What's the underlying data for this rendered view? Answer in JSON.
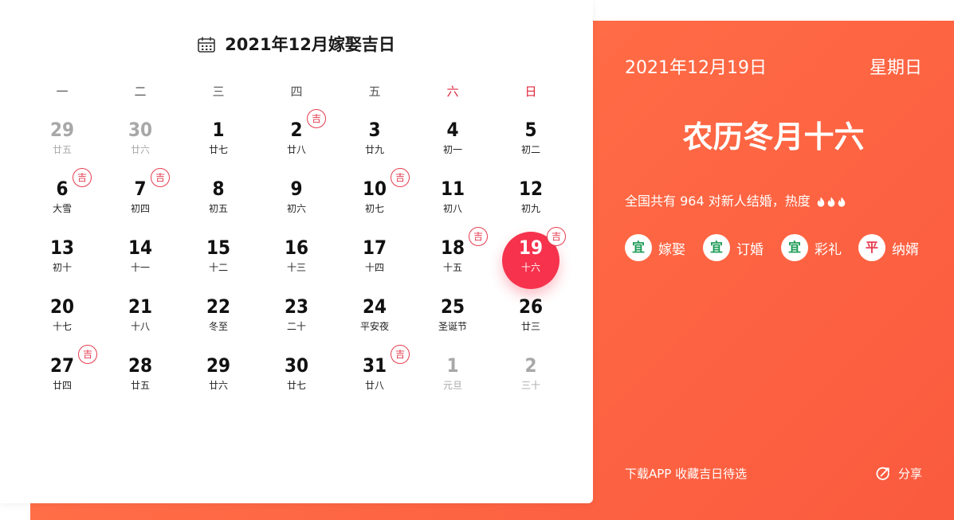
{
  "calendar": {
    "title": "2021年12月嫁娶吉日",
    "weekdays": [
      "一",
      "二",
      "三",
      "四",
      "五",
      "六",
      "日"
    ],
    "badge_label": "吉",
    "days": [
      {
        "num": "29",
        "lunar": "廿五",
        "muted": true,
        "ji": false
      },
      {
        "num": "30",
        "lunar": "廿六",
        "muted": true,
        "ji": false
      },
      {
        "num": "1",
        "lunar": "廿七",
        "muted": false,
        "ji": false
      },
      {
        "num": "2",
        "lunar": "廿八",
        "muted": false,
        "ji": true
      },
      {
        "num": "3",
        "lunar": "廿九",
        "muted": false,
        "ji": false
      },
      {
        "num": "4",
        "lunar": "初一",
        "muted": false,
        "ji": false
      },
      {
        "num": "5",
        "lunar": "初二",
        "muted": false,
        "ji": false
      },
      {
        "num": "6",
        "lunar": "大雪",
        "muted": false,
        "ji": true
      },
      {
        "num": "7",
        "lunar": "初四",
        "muted": false,
        "ji": true
      },
      {
        "num": "8",
        "lunar": "初五",
        "muted": false,
        "ji": false
      },
      {
        "num": "9",
        "lunar": "初六",
        "muted": false,
        "ji": false
      },
      {
        "num": "10",
        "lunar": "初七",
        "muted": false,
        "ji": true
      },
      {
        "num": "11",
        "lunar": "初八",
        "muted": false,
        "ji": false
      },
      {
        "num": "12",
        "lunar": "初九",
        "muted": false,
        "ji": false
      },
      {
        "num": "13",
        "lunar": "初十",
        "muted": false,
        "ji": false
      },
      {
        "num": "14",
        "lunar": "十一",
        "muted": false,
        "ji": false
      },
      {
        "num": "15",
        "lunar": "十二",
        "muted": false,
        "ji": false
      },
      {
        "num": "16",
        "lunar": "十三",
        "muted": false,
        "ji": false
      },
      {
        "num": "17",
        "lunar": "十四",
        "muted": false,
        "ji": false
      },
      {
        "num": "18",
        "lunar": "十五",
        "muted": false,
        "ji": true
      },
      {
        "num": "19",
        "lunar": "十六",
        "muted": false,
        "ji": true,
        "selected": true
      },
      {
        "num": "20",
        "lunar": "十七",
        "muted": false,
        "ji": false
      },
      {
        "num": "21",
        "lunar": "十八",
        "muted": false,
        "ji": false
      },
      {
        "num": "22",
        "lunar": "冬至",
        "muted": false,
        "ji": false
      },
      {
        "num": "23",
        "lunar": "二十",
        "muted": false,
        "ji": false
      },
      {
        "num": "24",
        "lunar": "平安夜",
        "muted": false,
        "ji": false
      },
      {
        "num": "25",
        "lunar": "圣诞节",
        "muted": false,
        "ji": false
      },
      {
        "num": "26",
        "lunar": "廿三",
        "muted": false,
        "ji": false
      },
      {
        "num": "27",
        "lunar": "廿四",
        "muted": false,
        "ji": true
      },
      {
        "num": "28",
        "lunar": "廿五",
        "muted": false,
        "ji": false
      },
      {
        "num": "29",
        "lunar": "廿六",
        "muted": false,
        "ji": false
      },
      {
        "num": "30",
        "lunar": "廿七",
        "muted": false,
        "ji": false
      },
      {
        "num": "31",
        "lunar": "廿八",
        "muted": false,
        "ji": true
      },
      {
        "num": "1",
        "lunar": "元旦",
        "muted": true,
        "ji": false
      },
      {
        "num": "2",
        "lunar": "三十",
        "muted": true,
        "ji": false
      }
    ]
  },
  "detail": {
    "date": "2021年12月19日",
    "weekday": "星期日",
    "lunar_date": "农历冬月十六",
    "stat_text": "全国共有 964 对新人结婚，热度",
    "heat_level": 3,
    "tags": [
      {
        "type": "宜",
        "label": "嫁娶"
      },
      {
        "type": "宜",
        "label": "订婚"
      },
      {
        "type": "宜",
        "label": "彩礼"
      },
      {
        "type": "平",
        "label": "纳婿"
      }
    ],
    "download_label": "下载APP 收藏吉日待选",
    "share_label": "分享"
  },
  "colors": {
    "accent_red": "#f6324d",
    "panel_orange": "#ff7b4c",
    "good_green": "#1c9b55"
  }
}
